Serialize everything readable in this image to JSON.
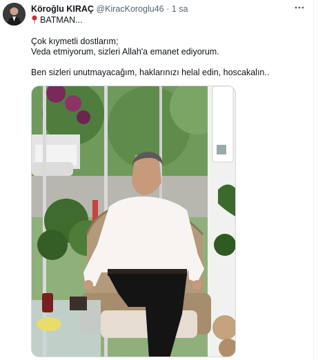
{
  "tweet": {
    "display_name": "Köroğlu KIRAÇ",
    "handle": "@KiracKoroglu46",
    "separator": "·",
    "time": "1 sa",
    "location_line": "BATMAN...",
    "line1": "Çok kıymetli dostlarım;",
    "line2": "Veda etmiyorum, sizleri Allah'a emanet ediyorum.",
    "line3": "Ben sizleri unutmayacağım,  haklarınızı helal edin, hoscakalın.."
  },
  "icons": {
    "more": "more-horizontal-icon",
    "location": "round-pushpin-icon"
  },
  "colors": {
    "text": "#0f1419",
    "secondary": "#536471",
    "pin": "#d7263d"
  }
}
